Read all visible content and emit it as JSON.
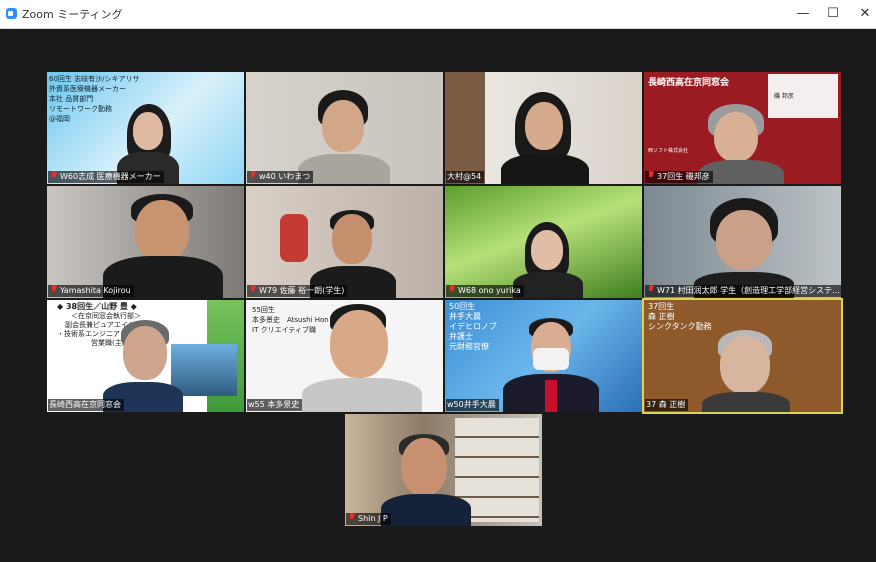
{
  "window": {
    "title": "Zoom ミーティング",
    "minimize": "—",
    "maximize": "☐",
    "close": "✕"
  },
  "participants": [
    {
      "name": "W60志成 医療機器メーカー",
      "overlay": [
        "60回生 志岐有沙/シキアリサ",
        "外資系医療機器メーカー",
        "本社 品質部門",
        "リモートワーク勤務",
        "@福岡"
      ]
    },
    {
      "name": "w40 いわまつ"
    },
    {
      "name": "大村@54"
    },
    {
      "name": "37回生 磯邦彦",
      "overlay": [
        "長崎西高在京同窓会",
        "西ソフト株式会社",
        "磯 邦彦"
      ]
    },
    {
      "name": "Yamashita Kojirou"
    },
    {
      "name": "W79 佐藤 裕一朗(学生)"
    },
    {
      "name": "W68 ono yurika"
    },
    {
      "name": "W71 村田润太郎 学生（創造理工学部経営システ..."
    },
    {
      "name": "長崎西高在京同窓会",
      "overlay": [
        "◆ 38回生／山野 豊 ◆",
        "＜在京同窓会執行部＞",
        "副会長兼ピュアエイジ担当",
        "・技術系エンジニアリング",
        "営業職(主に法人)"
      ]
    },
    {
      "name": "w55 本多景史",
      "overlay": [
        "55回生",
        "本多景史　Atsushi Hon",
        "IT クリエイティブ職"
      ]
    },
    {
      "name": "w50井手大晨",
      "overlay": [
        "50回生",
        "井手大晨",
        "イデヒロノブ",
        "弁護士",
        "元財務官僚"
      ]
    },
    {
      "name": "37 森 正樹",
      "overlay": [
        "37回生",
        "森 正樹",
        "シンクタンク勤務"
      ]
    },
    {
      "name": "Shin J P"
    }
  ]
}
